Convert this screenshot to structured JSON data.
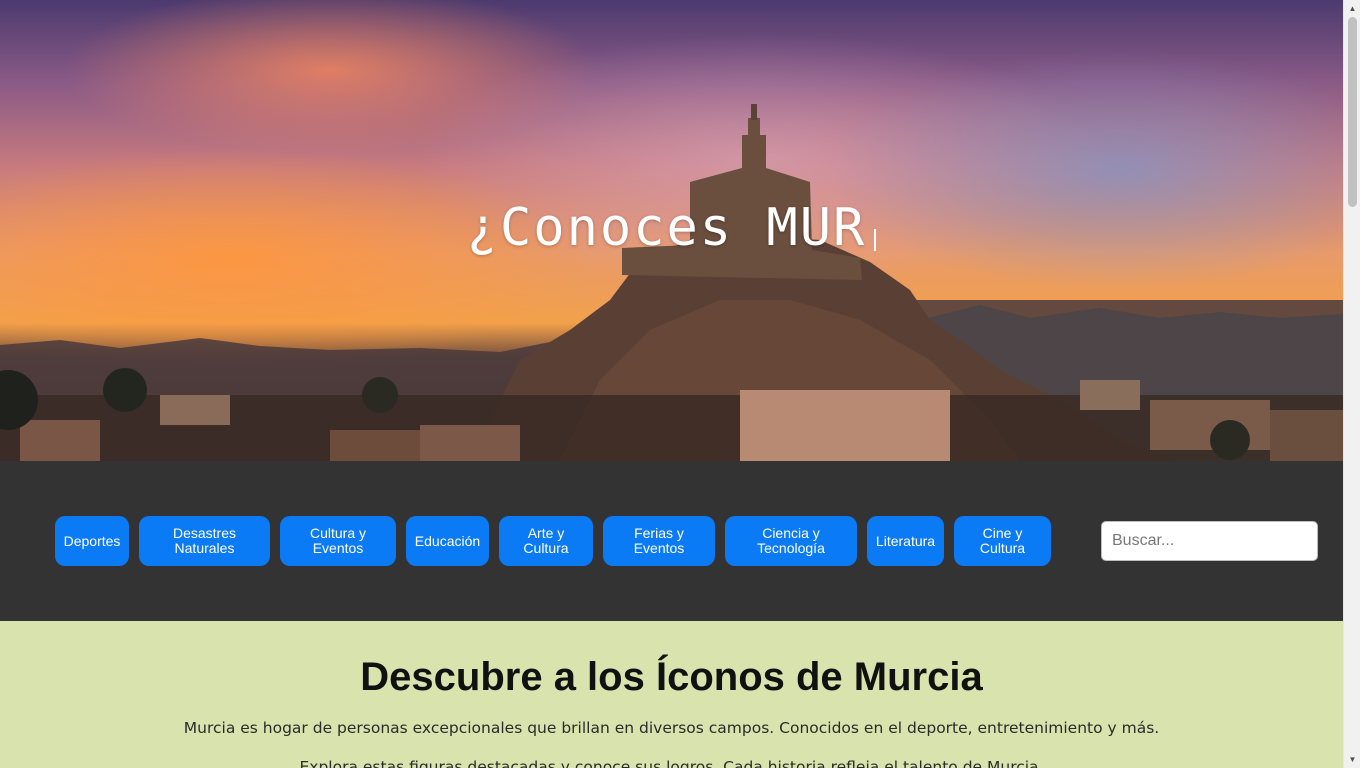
{
  "hero": {
    "title": "¿Conoces MUR"
  },
  "nav": {
    "categories": [
      {
        "label": "Deportes"
      },
      {
        "label": "Desastres Naturales"
      },
      {
        "label": "Cultura y Eventos"
      },
      {
        "label": "Educación"
      },
      {
        "label": "Arte y Cultura"
      },
      {
        "label": "Ferias y Eventos"
      },
      {
        "label": "Ciencia y Tecnología"
      },
      {
        "label": "Literatura"
      },
      {
        "label": "Cine y Cultura"
      }
    ],
    "search": {
      "placeholder": "Buscar...",
      "value": ""
    }
  },
  "main": {
    "heading": "Descubre a los Íconos de Murcia",
    "intro": "Murcia es hogar de personas excepcionales que brillan en diversos campos. Conocidos en el deporte, entretenimiento y más.",
    "intro2": "Explora estas figuras destacadas y conoce sus logros. Cada historia refleja el talento de Murcia."
  },
  "colors": {
    "button": "#0b7af5",
    "nav_bg": "#333333",
    "main_bg": "#d9e3ae"
  }
}
